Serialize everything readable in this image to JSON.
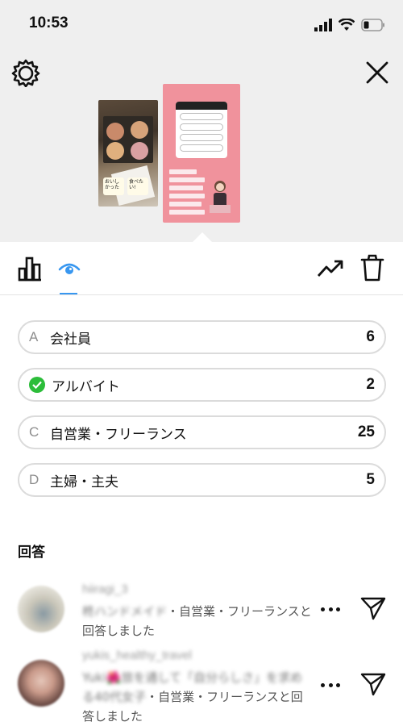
{
  "status_bar": {
    "time": "10:53"
  },
  "stories": {
    "thumb1_stickers": [
      "おいし\nかった",
      "食べた\nい!"
    ]
  },
  "tabs": {
    "active": "viewers"
  },
  "poll": {
    "options": [
      {
        "letter": "A",
        "label": "会社員",
        "count": "6",
        "selected": false
      },
      {
        "letter": "",
        "label": "アルバイト",
        "count": "2",
        "selected": true
      },
      {
        "letter": "C",
        "label": "自営業・フリーランス",
        "count": "25",
        "selected": false
      },
      {
        "letter": "D",
        "label": "主婦・主夫",
        "count": "5",
        "selected": false
      }
    ]
  },
  "responses_title": "回答",
  "responses": [
    {
      "username": "hiiragi_3",
      "bio": "柊ハンドメイド",
      "answer_text": "・自営業・フリーランスと回答しました"
    },
    {
      "username": "yukis_healthy_travel",
      "bio": "Yuki🌺旅を通して「自分らしさ」を求める40代女子",
      "answer_text": "・自営業・フリーランスと回答しました"
    }
  ],
  "colors": {
    "check_green": "#2cbd3a",
    "accent_blue": "#3897f0",
    "story_pink": "#f0929c"
  }
}
